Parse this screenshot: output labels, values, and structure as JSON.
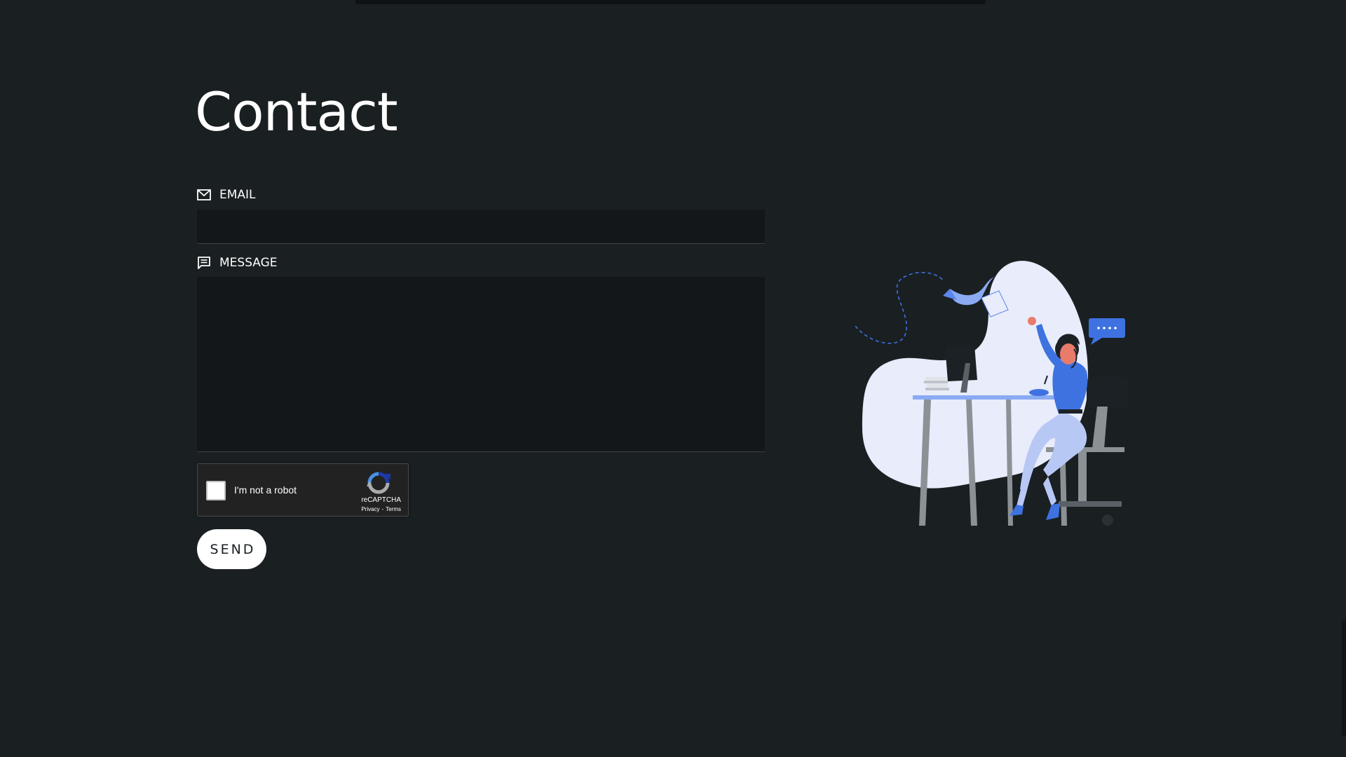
{
  "page": {
    "title": "Contact"
  },
  "form": {
    "email": {
      "label": "EMAIL",
      "value": "",
      "icon": "mail-icon"
    },
    "message": {
      "label": "MESSAGE",
      "value": "",
      "icon": "message-icon"
    },
    "recaptcha": {
      "label": "I'm not a robot",
      "brand": "reCAPTCHA",
      "privacy": "Privacy",
      "separator": "-",
      "terms": "Terms",
      "checked": false
    },
    "send_label": "SEND"
  },
  "colors": {
    "background": "#1a1f22",
    "input_background": "#141719",
    "accent_blue": "#3d72e0",
    "button_background": "#ffffff"
  }
}
